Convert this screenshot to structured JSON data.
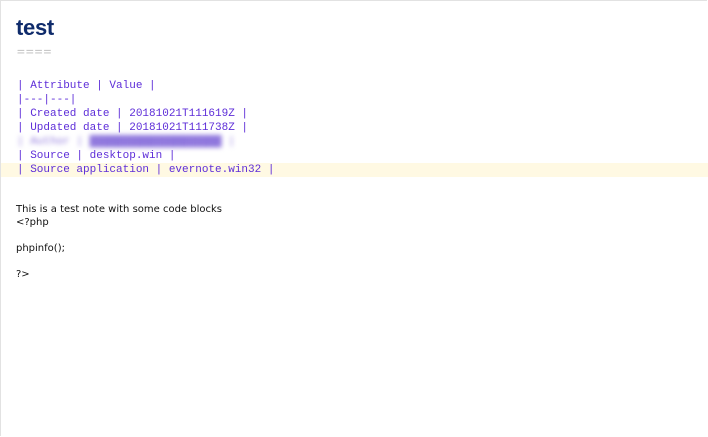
{
  "note": {
    "title": "test",
    "title_underline": "====",
    "code_lines": [
      "| Attribute | Value |",
      "|---|---|",
      "| Created date | 20181021T111619Z |",
      "| Updated date | 20181021T111738Z |"
    ],
    "blurred_line": "| Author | ████████████████████ |",
    "source_lines": [
      "| Source | desktop.win |",
      "| Source application | evernote.win32 |"
    ],
    "body_lines": [
      "This is a test note with some code blocks",
      "<?php",
      "",
      "phpinfo();",
      "",
      "?>"
    ]
  },
  "colors": {
    "title": "#0f2b6b",
    "code": "#5d2dd8",
    "highlight": "#fff9e3"
  }
}
